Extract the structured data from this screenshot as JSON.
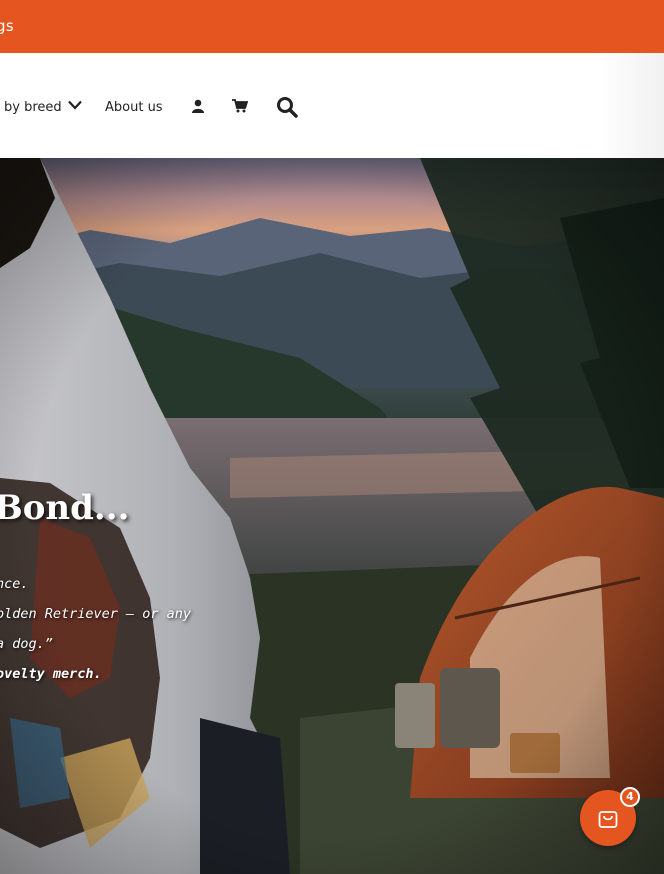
{
  "announcement": {
    "text": "gs"
  },
  "nav": {
    "shop_by_breed": "by breed",
    "about": "About us",
    "icons": [
      "user-icon",
      "cart-icon",
      "search-icon",
      "chevron-down-icon"
    ]
  },
  "hero": {
    "title": "Bond...",
    "line1": "nce.",
    "line2": "olden Retriever — or any",
    "line3": "a dog.”",
    "line4": "ovelty merch."
  },
  "floating_cart": {
    "count": "4",
    "icon": "shopping-bag-icon"
  },
  "colors": {
    "accent": "#e4551f",
    "header_bg": "#ffffff",
    "text_dark": "#222222"
  }
}
